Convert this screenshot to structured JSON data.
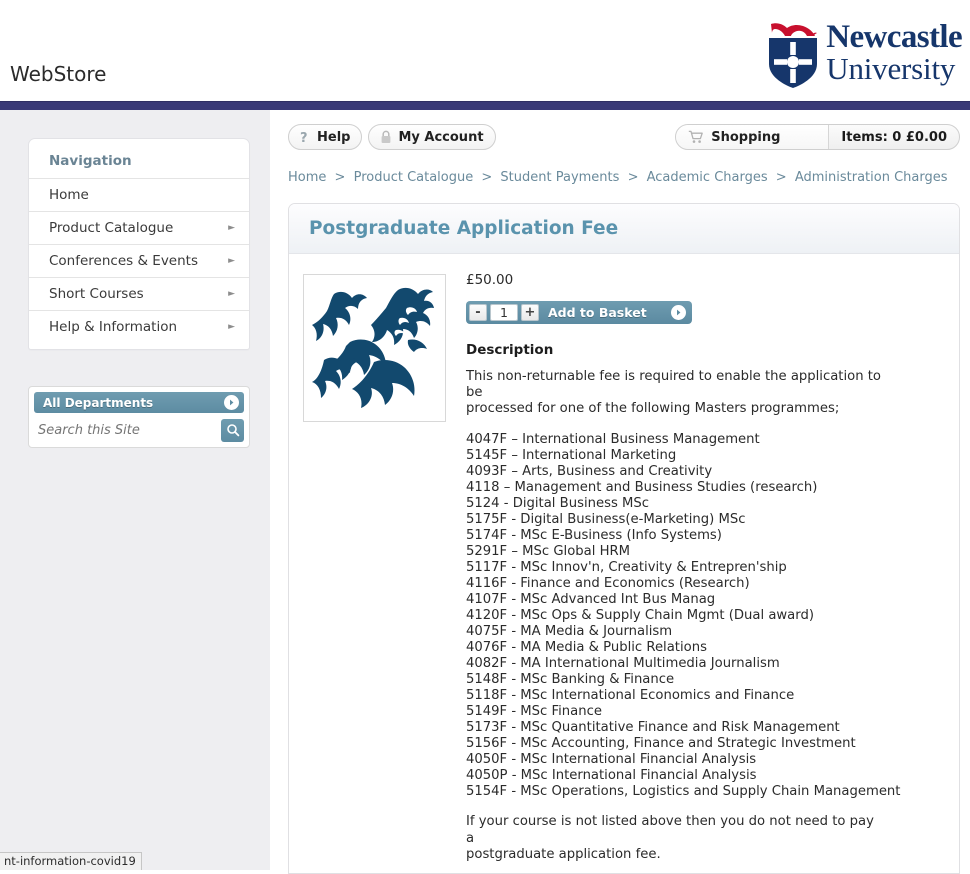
{
  "header": {
    "site_title": "WebStore",
    "logo": {
      "line1": "Newcastle",
      "line2": "University",
      "crest_icon": "university-crest-icon",
      "brand_blue": "#16366b",
      "brand_red": "#c8102e"
    },
    "nav_band_color": "#3a3a77"
  },
  "sidebar": {
    "nav_heading": "Navigation",
    "items": [
      {
        "label": "Home",
        "has_chevron": false
      },
      {
        "label": "Product Catalogue",
        "has_chevron": true
      },
      {
        "label": "Conferences & Events",
        "has_chevron": true
      },
      {
        "label": "Short Courses",
        "has_chevron": true
      },
      {
        "label": "Help & Information",
        "has_chevron": true
      }
    ],
    "departments": {
      "label": "All Departments",
      "arrow_icon": "chevron-right-circle-icon"
    },
    "search": {
      "placeholder": "Search this Site",
      "value": "",
      "button_icon": "search-icon"
    }
  },
  "toolbar": {
    "help_label": "Help",
    "help_icon": "question-mark-icon",
    "account_label": "My Account",
    "account_icon": "padlock-icon",
    "shopping_label": "Shopping",
    "shopping_icon": "shopping-cart-icon",
    "items_label": "Items: 0 £0.00"
  },
  "breadcrumb": {
    "separator": ">",
    "items": [
      "Home",
      "Product Catalogue",
      "Student Payments",
      "Academic Charges",
      "Administration Charges"
    ]
  },
  "product": {
    "title": "Postgraduate Application Fee",
    "image_icon": "heraldic-lion-icon",
    "price": "£50.00",
    "quantity": "1",
    "decrement_label": "-",
    "increment_label": "+",
    "add_to_basket_label": "Add to Basket",
    "add_arrow_icon": "chevron-right-circle-icon",
    "description_heading": "Description",
    "description_intro_line1": "This non-returnable fee is required to enable the application to be",
    "description_intro_line2": "processed for one of the following Masters programmes;",
    "courses": [
      "4047F – International Business Management",
      "5145F – International Marketing",
      "4093F – Arts, Business and Creativity",
      "4118 – Management and Business Studies (research)",
      "5124 - Digital Business MSc",
      "5175F - Digital Business(e-Marketing) MSc",
      "5174F - MSc E-Business (Info Systems)",
      "5291F – MSc Global HRM",
      "5117F - MSc Innov'n, Creativity & Entrepren'ship",
      "4116F - Finance and Economics (Research)",
      "4107F - MSc Advanced Int Bus Manag",
      "4120F - MSc Ops & Supply Chain Mgmt (Dual award)",
      "4075F - MA Media & Journalism",
      "4076F - MA Media & Public Relations",
      "4082F - MA International Multimedia Journalism",
      "5148F - MSc Banking & Finance",
      "5118F - MSc International Economics and Finance",
      "5149F - MSc Finance",
      "5173F - MSc Quantitative Finance and Risk Management",
      "5156F - MSc Accounting, Finance and Strategic Investment",
      "4050F - MSc International Financial Analysis",
      "4050P - MSc International Financial Analysis",
      "5154F - MSc Operations, Logistics and Supply Chain Management"
    ],
    "footer_line1": "If your course is not listed above then you do not need to pay a",
    "footer_line2": "postgraduate application fee."
  },
  "status_bar": {
    "url_text": "nt-information-covid19"
  }
}
